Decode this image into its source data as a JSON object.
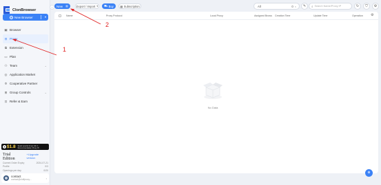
{
  "app": {
    "name": "ClonBrowser",
    "version": "5.6.3"
  },
  "sidebar": {
    "new_browser_label": "New Browser",
    "items": [
      {
        "label": "Browser",
        "icon": "browser-icon"
      },
      {
        "label": "Proxy",
        "icon": "proxy-icon",
        "active": true
      },
      {
        "label": "Extension",
        "icon": "extension-icon"
      },
      {
        "label": "Plan",
        "icon": "plan-icon"
      },
      {
        "label": "Team",
        "icon": "team-icon",
        "expandable": true
      },
      {
        "label": "Application Market",
        "icon": "market-icon"
      },
      {
        "label": "Cooperative Partner",
        "icon": "partner-icon"
      },
      {
        "label": "Group Controls",
        "icon": "group-icon",
        "expandable": true
      },
      {
        "label": "Refer & Earn",
        "icon": "refer-icon"
      }
    ],
    "promo": {
      "price": "$1.8",
      "text_line1": "Spark special times 1ifo 1...",
      "text_line2": "Recommendation Proxy IP..."
    },
    "plan": {
      "name": "Trial Edition",
      "upgrade_label": "+Upgrade version",
      "rows": [
        {
          "label": "Current Order Expiry",
          "value": "2024-07-21"
        },
        {
          "label": "Profile",
          "value": "0/3"
        },
        {
          "label": "Openings per day",
          "value": "0/20"
        }
      ]
    },
    "user": {
      "name": "contact",
      "email": "contact@cloffproxy..."
    }
  },
  "toolbar": {
    "new_label": "New",
    "export_label": "Export / Import",
    "buy_label": "Buy",
    "subscription_label": "Subscription",
    "filter_value": "All",
    "filter_count": "0",
    "search_placeholder": "Search Name/Proxy IP"
  },
  "table": {
    "columns": [
      "Name",
      "Proxy Protocol",
      "Local Proxy",
      "Assigned Brows",
      "Creation Time",
      "Update Time",
      "Operation"
    ]
  },
  "empty_text": "No Data",
  "annotations": {
    "one": "1",
    "two": "2"
  },
  "colors": {
    "accent": "#3b82f6",
    "annotation": "#e02020"
  }
}
